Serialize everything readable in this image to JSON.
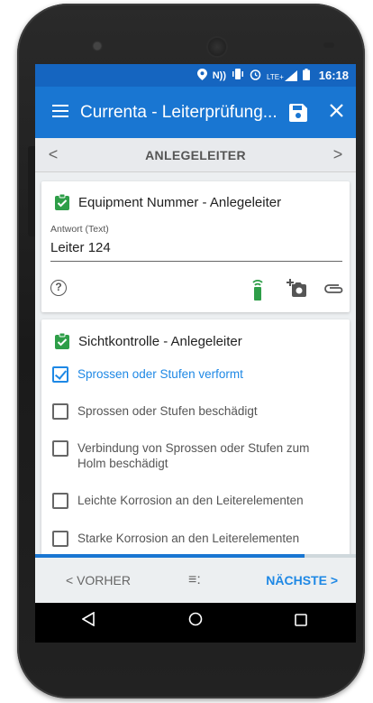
{
  "status_bar": {
    "icons": [
      "location-icon",
      "nfc-icon",
      "vibrate-icon",
      "alarm-icon",
      "lte-signal-icon",
      "battery-icon"
    ],
    "lte": "LTE+",
    "time": "16:18"
  },
  "app_bar": {
    "title": "Currenta - Leiterprüfung...",
    "menu_icon": "menu-icon",
    "save_icon": "save-icon",
    "close_icon": "close-icon"
  },
  "section_nav": {
    "prev": "<",
    "label": "ANLEGELEITER",
    "next": ">"
  },
  "card_equipment": {
    "title": "Equipment Nummer - Anlegeleiter",
    "answer_label": "Antwort (Text)",
    "answer_value": "Leiter 124",
    "help": "?"
  },
  "card_visual": {
    "title": "Sichtkontrolle - Anlegeleiter",
    "items": [
      {
        "label": "Sprossen oder Stufen verformt",
        "checked": true
      },
      {
        "label": "Sprossen oder Stufen beschädigt",
        "checked": false
      },
      {
        "label": "Verbindung von Sprossen oder Stufen zum Holm beschädigt",
        "checked": false
      },
      {
        "label": "Leichte Korrosion an den Leiterelementen",
        "checked": false
      },
      {
        "label": "Starke Korrosion an den Leiterelementen",
        "checked": false
      }
    ]
  },
  "progress": 0.84,
  "action_bar": {
    "prev_label": "< VORHER",
    "menu_symbol": "≡:",
    "next_label": "NÄCHSTE >"
  },
  "colors": {
    "primary": "#1976d2",
    "status": "#1565c0",
    "accent": "#1e88e5",
    "check_green": "#2e9e48"
  }
}
